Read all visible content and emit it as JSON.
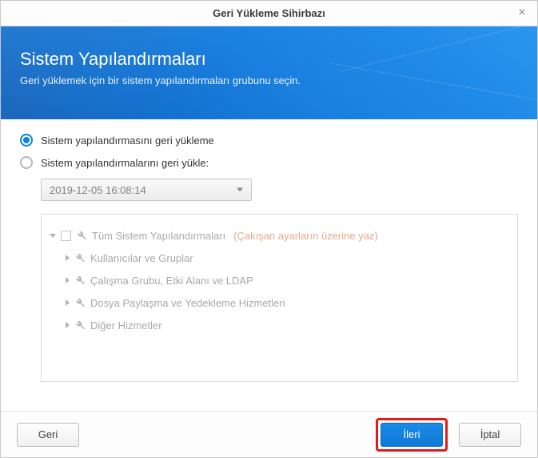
{
  "window": {
    "title": "Geri Yükleme Sihirbazı"
  },
  "banner": {
    "title": "Sistem Yapılandırmaları",
    "subtitle": "Geri yüklemek için bir sistem yapılandırmaları grubunu seçin."
  },
  "options": {
    "restore_config_label": "Sistem yapılandırmasını geri yükleme",
    "restore_configs_label": "Sistem yapılandırmalarını geri yükle:",
    "selected": "restore_config"
  },
  "dropdown": {
    "value": "2019-12-05 16:08:14"
  },
  "tree": {
    "root": {
      "label": "Tüm Sistem Yapılandırmaları",
      "note": "(Çakışan ayarların üzerine yaz)"
    },
    "items": [
      {
        "label": "Kullanıcılar ve Gruplar"
      },
      {
        "label": "Çalışma Grubu, Etki Alanı ve LDAP"
      },
      {
        "label": "Dosya Paylaşma ve Yedekleme Hizmetleri"
      },
      {
        "label": "Diğer Hizmetler"
      }
    ]
  },
  "footer": {
    "back": "Geri",
    "next": "İleri",
    "cancel": "İptal"
  }
}
